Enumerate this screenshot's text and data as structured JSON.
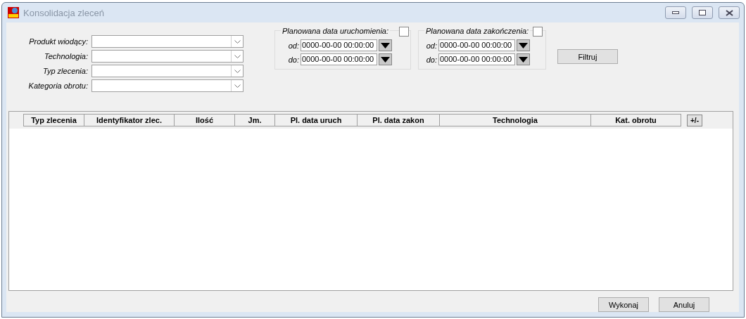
{
  "window": {
    "title": "Konsolidacja zleceń"
  },
  "filters": [
    {
      "label": "Produkt wiodący:"
    },
    {
      "label": "Technologia:"
    },
    {
      "label": "Typ zlecenia:"
    },
    {
      "label": "Kategoria obrotu:"
    }
  ],
  "date_groups": [
    {
      "title": "Planowana data uruchomienia:",
      "checked": false,
      "rows": [
        {
          "label": "od:",
          "value": "0000-00-00 00:00:00"
        },
        {
          "label": "do:",
          "value": "0000-00-00 00:00:00"
        }
      ]
    },
    {
      "title": "Planowana data zakończenia:",
      "checked": false,
      "rows": [
        {
          "label": "od:",
          "value": "0000-00-00 00:00:00"
        },
        {
          "label": "do:",
          "value": "0000-00-00 00:00:00"
        }
      ]
    }
  ],
  "filter_button": "Filtruj",
  "table": {
    "columns": [
      "Typ zlecenia",
      "Identyfikator zlec.",
      "Ilość",
      "Jm.",
      "Pl. data uruch",
      "Pl. data zakon",
      "Technologia",
      "Kat. obrotu"
    ],
    "toggle_button": "+/-"
  },
  "buttons": [
    "Wykonaj",
    "Anuluj"
  ]
}
